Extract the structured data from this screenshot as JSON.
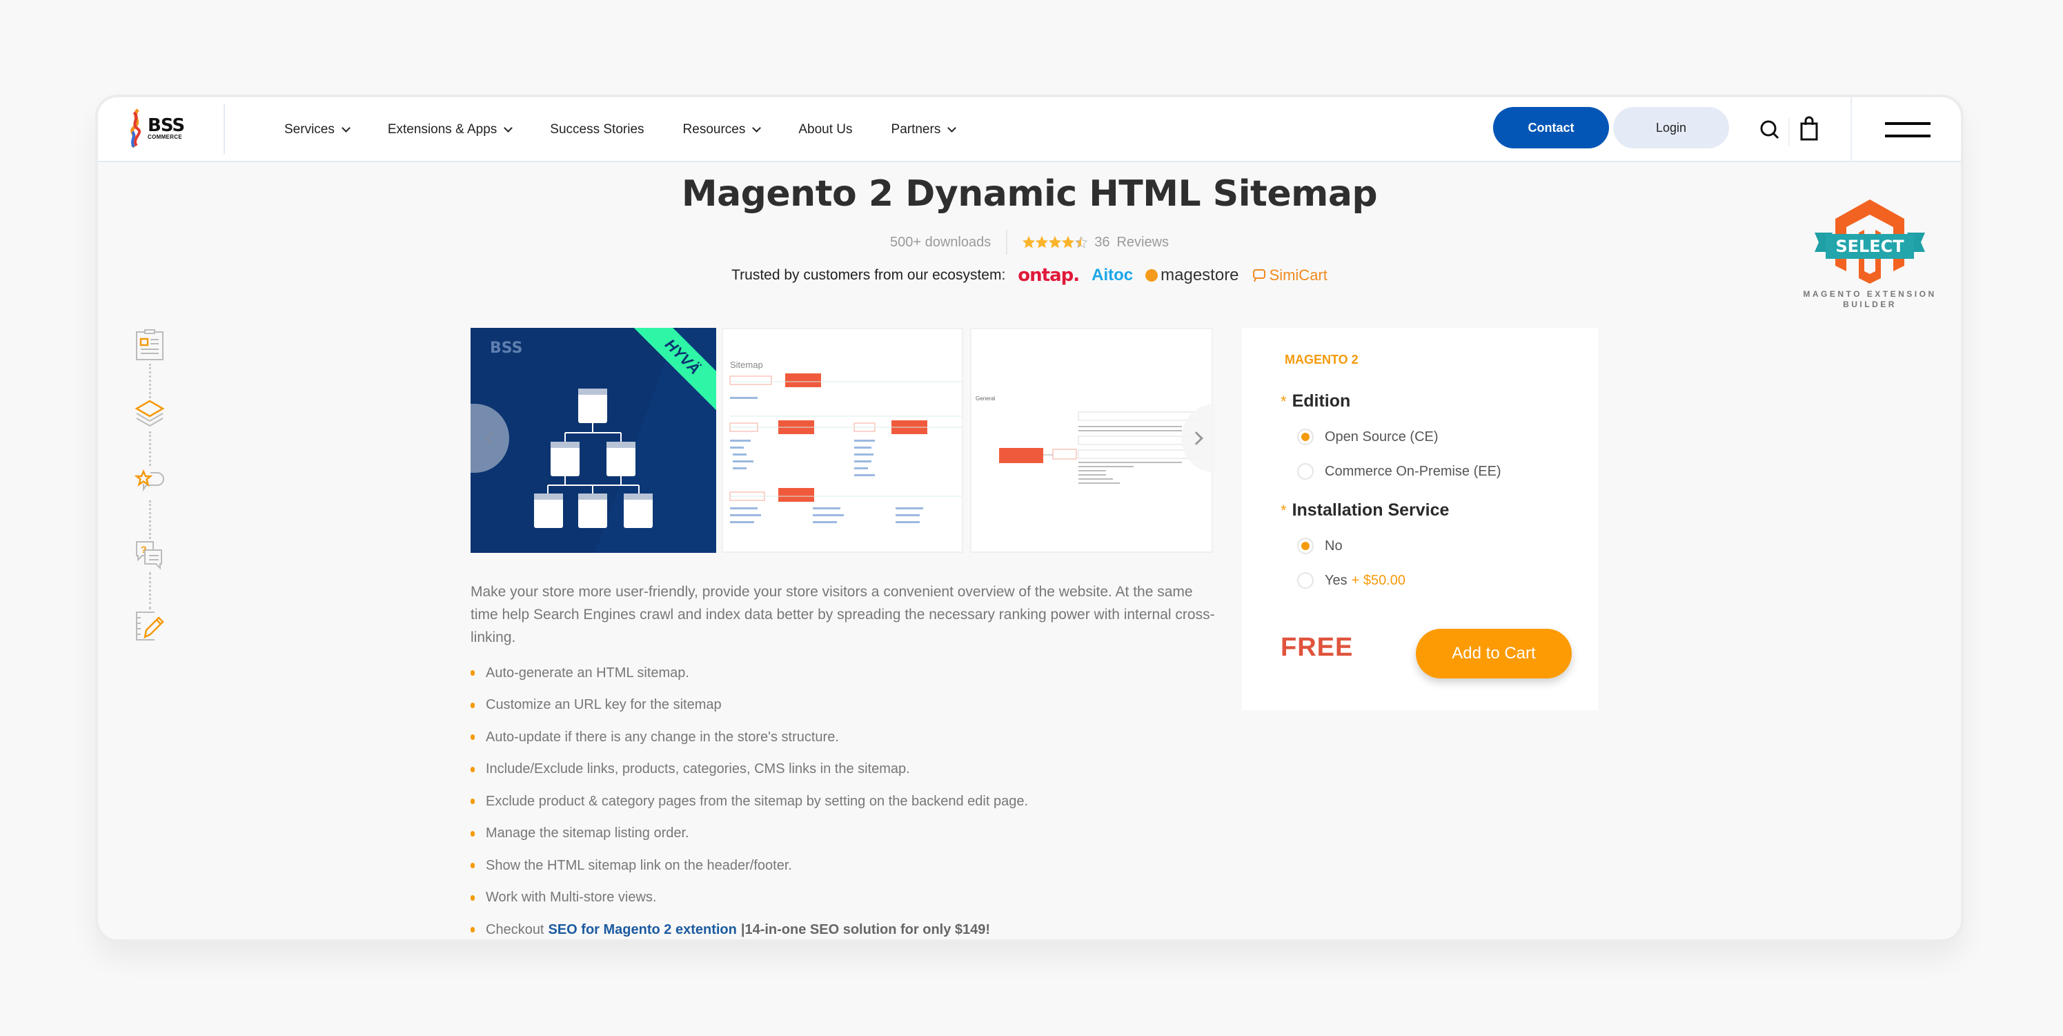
{
  "header": {
    "logo": {
      "name": "BSS",
      "sub": "COMMERCE"
    },
    "nav": [
      {
        "label": "Services",
        "has_dropdown": true
      },
      {
        "label": "Extensions & Apps",
        "has_dropdown": true
      },
      {
        "label": "Success Stories",
        "has_dropdown": false
      },
      {
        "label": "Resources",
        "has_dropdown": true
      },
      {
        "label": "About Us",
        "has_dropdown": false
      },
      {
        "label": "Partners",
        "has_dropdown": true
      }
    ],
    "contact_label": "Contact",
    "login_label": "Login",
    "icons": [
      "search-icon",
      "shopping-bag-icon",
      "hamburger-menu-icon"
    ]
  },
  "product": {
    "title": "Magento 2 Dynamic HTML Sitemap",
    "downloads": "500+ downloads",
    "rating": 4.5,
    "rating_max": 5,
    "reviews_count": "36",
    "reviews_label": "Reviews",
    "trusted_label": "Trusted by customers from our ecosystem:",
    "partners": [
      "ontap.",
      "Aitoc",
      "magestore",
      "SimiCart"
    ],
    "badge": {
      "title": "SELECT",
      "caption_line1": "MAGENTO EXTENSION",
      "caption_line2": "BUILDER"
    }
  },
  "side_nav": [
    {
      "icon": "overview-clipboard-icon"
    },
    {
      "icon": "layers-icon"
    },
    {
      "icon": "star-review-icon"
    },
    {
      "icon": "faq-chat-icon"
    },
    {
      "icon": "edit-notes-icon"
    }
  ],
  "gallery": {
    "slides": [
      {
        "caption": "HYVÄ",
        "kind": "cover"
      },
      {
        "caption": "Sitemap",
        "kind": "screenshot"
      },
      {
        "caption": "General",
        "kind": "screenshot"
      }
    ]
  },
  "description": "Make your store more user-friendly, provide your store visitors a convenient overview of the website. At the same time help Search Engines crawl and index data better by spreading the necessary ranking power with internal cross-linking.",
  "features": [
    "Auto-generate an HTML sitemap.",
    "Customize an URL key for the sitemap",
    "Auto-update if there is any change in the store's structure.",
    "Include/Exclude links, products, categories, CMS links in the sitemap.",
    "Exclude product & category pages from the sitemap by setting on the backend edit page.",
    "Manage the sitemap listing order.",
    "Show the HTML sitemap link on the header/footer.",
    "Work with Multi-store views."
  ],
  "promo": {
    "prefix": "Checkout",
    "link_text": "SEO for Magento 2 extention",
    "suffix": "|14-in-one SEO solution for only $149!"
  },
  "buybox": {
    "platform": "MAGENTO 2",
    "required_mark": "*",
    "edition": {
      "label": "Edition",
      "options": [
        {
          "label": "Open Source (CE)",
          "selected": true
        },
        {
          "label": "Commerce On-Premise (EE)",
          "selected": false
        }
      ]
    },
    "installation": {
      "label": "Installation Service",
      "options": [
        {
          "label": "No",
          "extra": "",
          "selected": true
        },
        {
          "label": "Yes",
          "extra": "+ $50.00",
          "selected": false
        }
      ]
    },
    "price": "FREE",
    "add_to_cart_label": "Add to Cart"
  },
  "colors": {
    "primary_blue": "#0456b6",
    "accent_orange": "#f59a0c",
    "cta_orange": "#fc9b04",
    "price_red": "#e0533c",
    "link_blue": "#1c5aa0"
  }
}
